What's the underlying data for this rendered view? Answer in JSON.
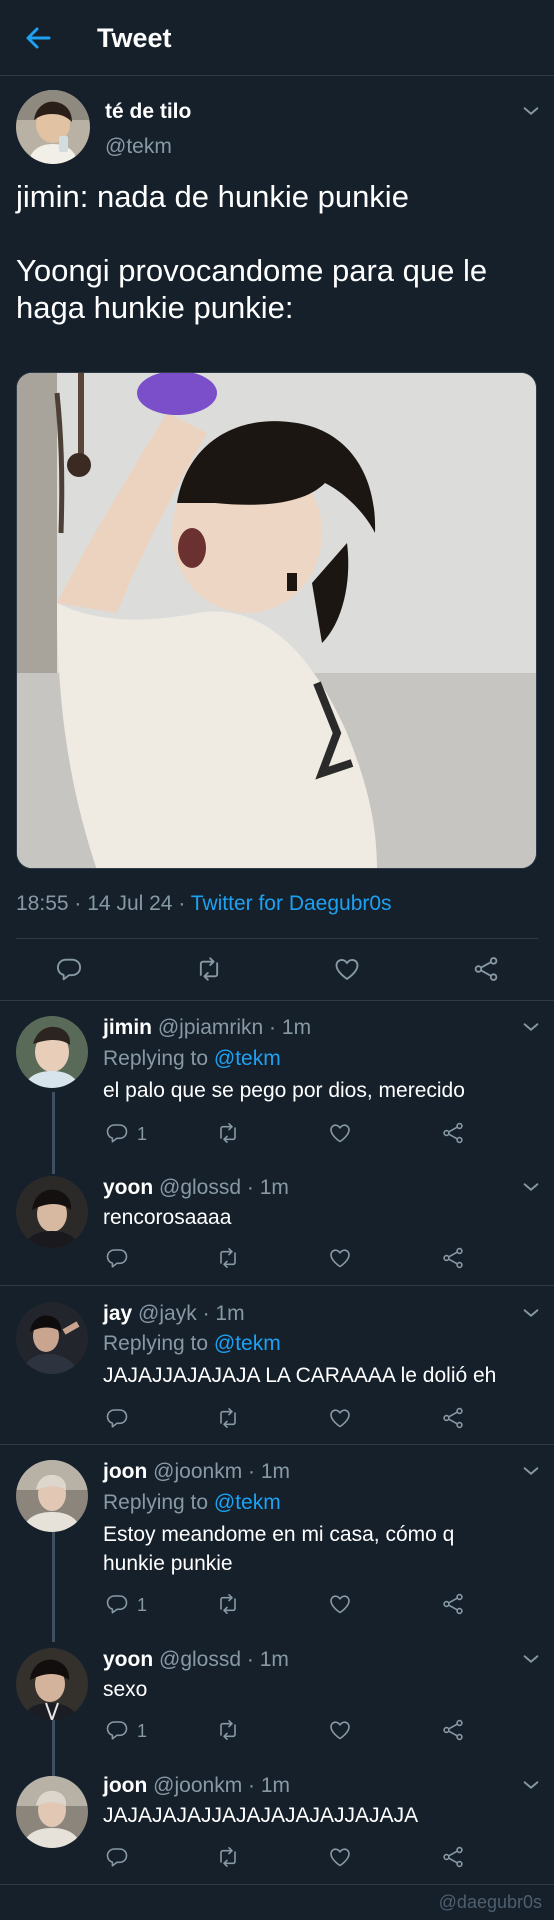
{
  "header": {
    "title": "Tweet"
  },
  "tweet": {
    "author_name": "té de tilo",
    "author_handle": "@tekm",
    "text": "jimin: nada de hunkie punkie\n\nYoongi provocandome para que le haga hunkie punkie:",
    "time": "18:55",
    "date": "14 Jul 24",
    "source": "Twitter for Daegubr0s",
    "dot": "·"
  },
  "replies": [
    {
      "name": "jimin",
      "handle": "@jpiamrikn",
      "time": "1m",
      "replying_prefix": "Replying to",
      "replying_to": "@tekm",
      "text": "el palo que se pego por dios, merecido",
      "reply_count": "1"
    },
    {
      "name": "yoon",
      "handle": "@glossd",
      "time": "1m",
      "text": "rencorosaaaa"
    },
    {
      "name": "jay",
      "handle": "@jayk",
      "time": "1m",
      "replying_prefix": "Replying to",
      "replying_to": "@tekm",
      "text": "JAJAJJAJAJAJA LA CARAAAA le dolió eh"
    },
    {
      "name": "joon",
      "handle": "@joonkm",
      "time": "1m",
      "replying_prefix": "Replying to",
      "replying_to": "@tekm",
      "text": "Estoy meandome en mi casa, cómo q\nhunkie punkie",
      "reply_count": "1"
    },
    {
      "name": "yoon",
      "handle": "@glossd",
      "time": "1m",
      "text": "sexo",
      "reply_count": "1"
    },
    {
      "name": "joon",
      "handle": "@joonkm",
      "time": "1m",
      "text": "JAJAJAJAJJAJAJAJAJAJJAJAJA"
    }
  ],
  "watermark": "@daegubr0s",
  "colors": {
    "background": "#15202b",
    "accent": "#1da1f2",
    "muted": "#8899a6",
    "divider": "#2f3b47"
  },
  "icons": [
    "back-arrow-icon",
    "chevron-down-icon",
    "reply-icon",
    "retweet-icon",
    "like-icon",
    "share-icon"
  ]
}
